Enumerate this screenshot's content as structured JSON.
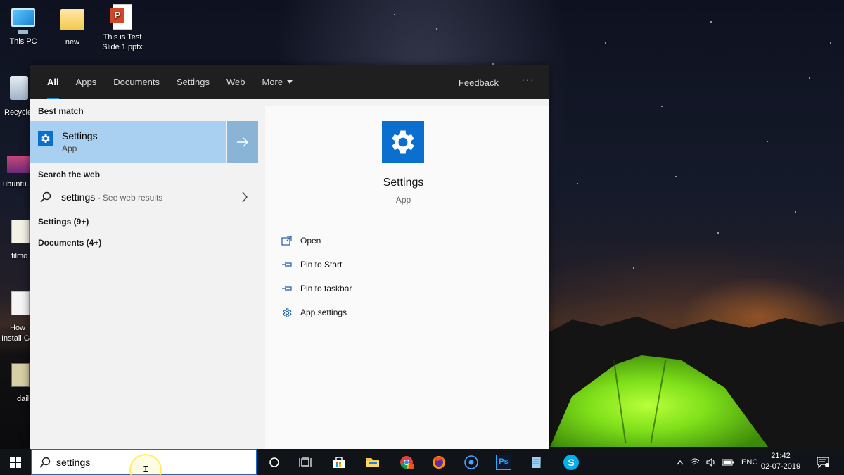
{
  "desktop": {
    "icons": [
      {
        "label": "This PC"
      },
      {
        "label": "new"
      },
      {
        "label": "This is Test Slide 1.pptx"
      }
    ],
    "partial_icons": [
      {
        "label": "Recycle"
      },
      {
        "label": "ubuntu."
      },
      {
        "label": "filmo"
      },
      {
        "label": "How"
      },
      {
        "label": "Install Gu"
      },
      {
        "label": "dail"
      }
    ]
  },
  "search_panel": {
    "tabs": [
      {
        "label": "All",
        "active": true
      },
      {
        "label": "Apps"
      },
      {
        "label": "Documents"
      },
      {
        "label": "Settings"
      },
      {
        "label": "Web"
      },
      {
        "label": "More"
      }
    ],
    "feedback_label": "Feedback",
    "ellipsis_label": "···",
    "best_match": {
      "section_label": "Best match",
      "name": "Settings",
      "type": "App"
    },
    "search_web": {
      "section_label": "Search the web",
      "query": "settings",
      "suffix": " - See web results"
    },
    "categories": [
      {
        "label": "Settings (9+)"
      },
      {
        "label": "Documents (4+)"
      }
    ],
    "preview": {
      "title": "Settings",
      "subtitle": "App",
      "actions": [
        {
          "label": "Open",
          "icon": "open-icon"
        },
        {
          "label": "Pin to Start",
          "icon": "pin-icon"
        },
        {
          "label": "Pin to taskbar",
          "icon": "pin-icon"
        },
        {
          "label": "App settings",
          "icon": "gear-icon"
        }
      ]
    }
  },
  "taskbar": {
    "search_value": "settings",
    "cursor_glyph": "I",
    "apps": [
      "cortana-icon",
      "task-view-icon",
      "store-icon",
      "file-explorer-icon",
      "chrome-icon",
      "firefox-icon",
      "media-icon",
      "photoshop-icon",
      "notepad-icon",
      "skype-icon"
    ],
    "photoshop_label": "Ps",
    "skype_label": "S",
    "tray": {
      "language": "ENG",
      "time": "21:42",
      "date": "02-07-2019"
    }
  },
  "colors": {
    "accent": "#0a6fce",
    "selection": "#a9d0f0",
    "taskbar": "#101419",
    "tabbar": "#1f1f1f"
  }
}
